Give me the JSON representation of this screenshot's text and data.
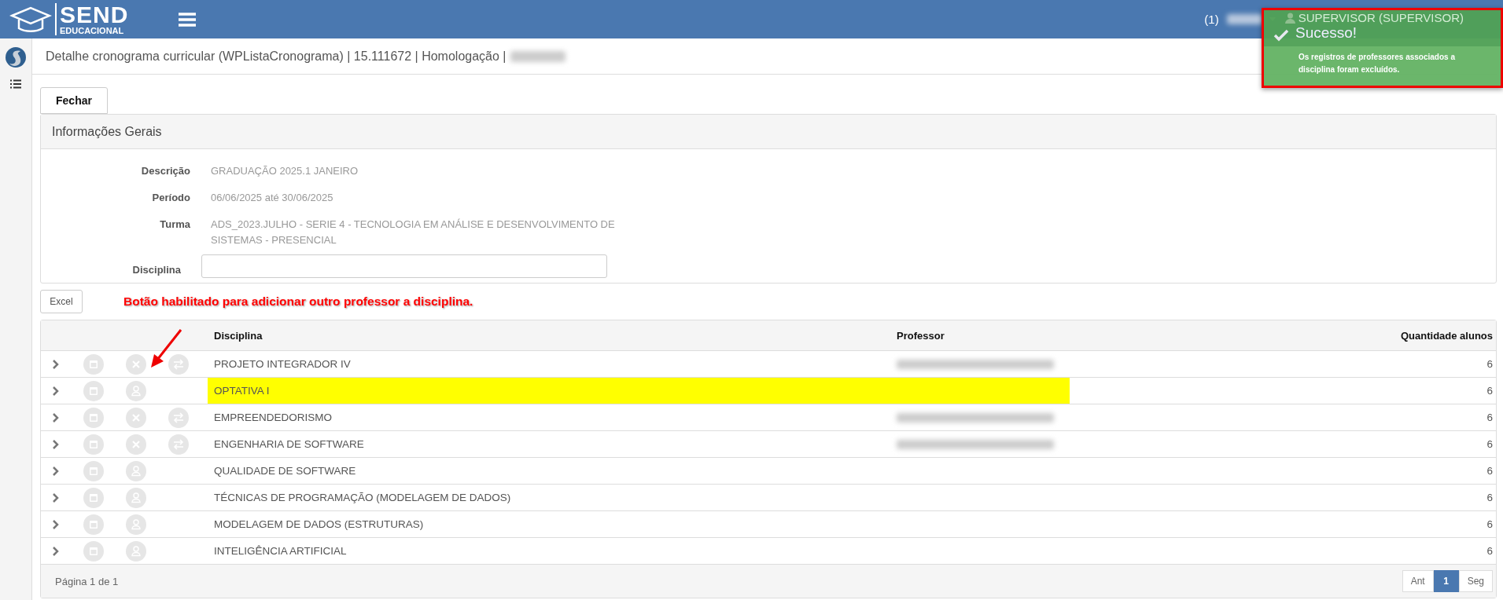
{
  "header": {
    "brand": {
      "title": "SEND",
      "subtitle": "EDUCACIONAL"
    },
    "notifications": "(1)",
    "user_blurred": true,
    "user_menu": "SUPERVISOR (SUPERVISOR)"
  },
  "toast": {
    "title": "Sucesso!",
    "message": "Os registros de professores associados a disciplina foram excluídos."
  },
  "breadcrumb": {
    "text": "Detalhe cronograma curricular (WPListaCronograma) | 15.111672 | Homologação |",
    "env_blurred": true
  },
  "close_button": "Fechar",
  "panel": {
    "title": "Informações Gerais",
    "fields": [
      {
        "label": "Descrição",
        "value": "GRADUAÇÃO 2025.1 JANEIRO",
        "kind": "text"
      },
      {
        "label": "Período",
        "value": "06/06/2025 até 30/06/2025",
        "kind": "text"
      },
      {
        "label": "Turma",
        "value": "ADS_2023.JULHO - SERIE 4 - TECNOLOGIA EM ANÁLISE E DESENVOLVIMENTO DE SISTEMAS - PRESENCIAL",
        "kind": "text"
      },
      {
        "label": "Disciplina",
        "kind": "input"
      }
    ]
  },
  "excel_button": "Excel",
  "annotation": "Botão habilitado para adicionar outro professor a disciplina.",
  "table": {
    "columns": [
      "Disciplina",
      "Professor",
      "Quantidade alunos"
    ],
    "rows": [
      {
        "disciplina": "PROJETO INTEGRADOR IV",
        "kind": "assigned",
        "professor_blurred": true,
        "highlighted": false,
        "quantidade": "6"
      },
      {
        "disciplina": "OPTATIVA I",
        "kind": "unassigned",
        "professor_blurred": false,
        "highlighted": true,
        "quantidade": "6"
      },
      {
        "disciplina": "EMPREENDEDORISMO",
        "kind": "assigned",
        "professor_blurred": true,
        "highlighted": false,
        "quantidade": "6"
      },
      {
        "disciplina": "ENGENHARIA DE SOFTWARE",
        "kind": "assigned",
        "professor_blurred": true,
        "highlighted": false,
        "quantidade": "6"
      },
      {
        "disciplina": "QUALIDADE DE SOFTWARE",
        "kind": "unassigned",
        "professor_blurred": false,
        "highlighted": false,
        "quantidade": "6"
      },
      {
        "disciplina": "TÉCNICAS DE PROGRAMAÇÃO (MODELAGEM DE DADOS)",
        "kind": "unassigned",
        "professor_blurred": false,
        "highlighted": false,
        "quantidade": "6"
      },
      {
        "disciplina": "MODELAGEM DE DADOS (ESTRUTURAS)",
        "kind": "unassigned",
        "professor_blurred": false,
        "highlighted": false,
        "quantidade": "6"
      },
      {
        "disciplina": "INTELIGÊNCIA ARTIFICIAL",
        "kind": "unassigned",
        "professor_blurred": false,
        "highlighted": false,
        "quantidade": "6"
      }
    ],
    "footer": "Página 1 de 1",
    "pagination": [
      {
        "label": "Ant",
        "selected": false
      },
      {
        "label": "1",
        "selected": true
      },
      {
        "label": "Seg",
        "selected": false
      }
    ]
  }
}
